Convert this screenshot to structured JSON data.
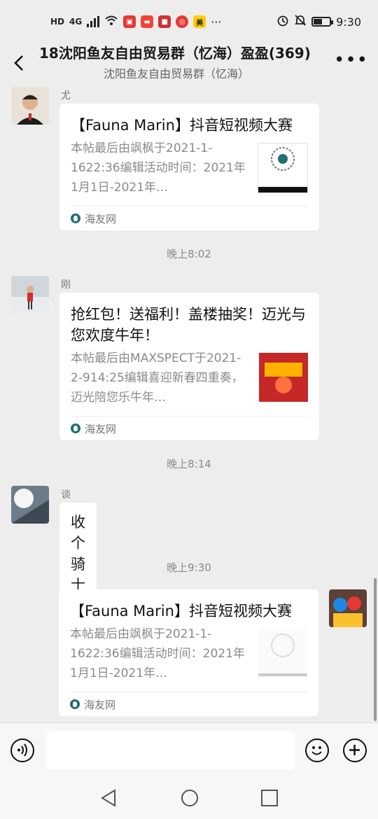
{
  "status": {
    "time": "9:30",
    "network": "4G",
    "hd": "HD"
  },
  "header": {
    "title": "18沈阳鱼友自由贸易群（忆海）盈盈(369)",
    "subtitle": "沈阳鱼友自由贸易群（忆海）"
  },
  "messages": [
    {
      "sender": "尤其是",
      "card_title": "【Fauna Marin】抖音短视频大赛",
      "card_desc": "本帖最后由飒枫于2021-1-1622:36编辑活动时间：2021年1月1日-2021年…",
      "source": "海友网"
    },
    {
      "time": "晚上8:02"
    },
    {
      "sender": "刚哥",
      "card_title": "抢红包！送福利！盖楼抽奖！迈光与您欢度牛年！",
      "card_desc": "本帖最后由MAXSPECT于2021-2-914:25编辑喜迎新春四重奏，迈光陪您乐牛年…",
      "source": "海友网"
    },
    {
      "time": "晚上8:14"
    },
    {
      "sender": "谈笑风生",
      "text": "收个骑士"
    },
    {
      "time": "晚上9:30"
    },
    {
      "card_title": "【Fauna Marin】抖音短视频大赛",
      "card_desc": "本帖最后由飒枫于2021-1-1622:36编辑活动时间：2021年1月1日-2021年…",
      "source": "海友网"
    }
  ]
}
